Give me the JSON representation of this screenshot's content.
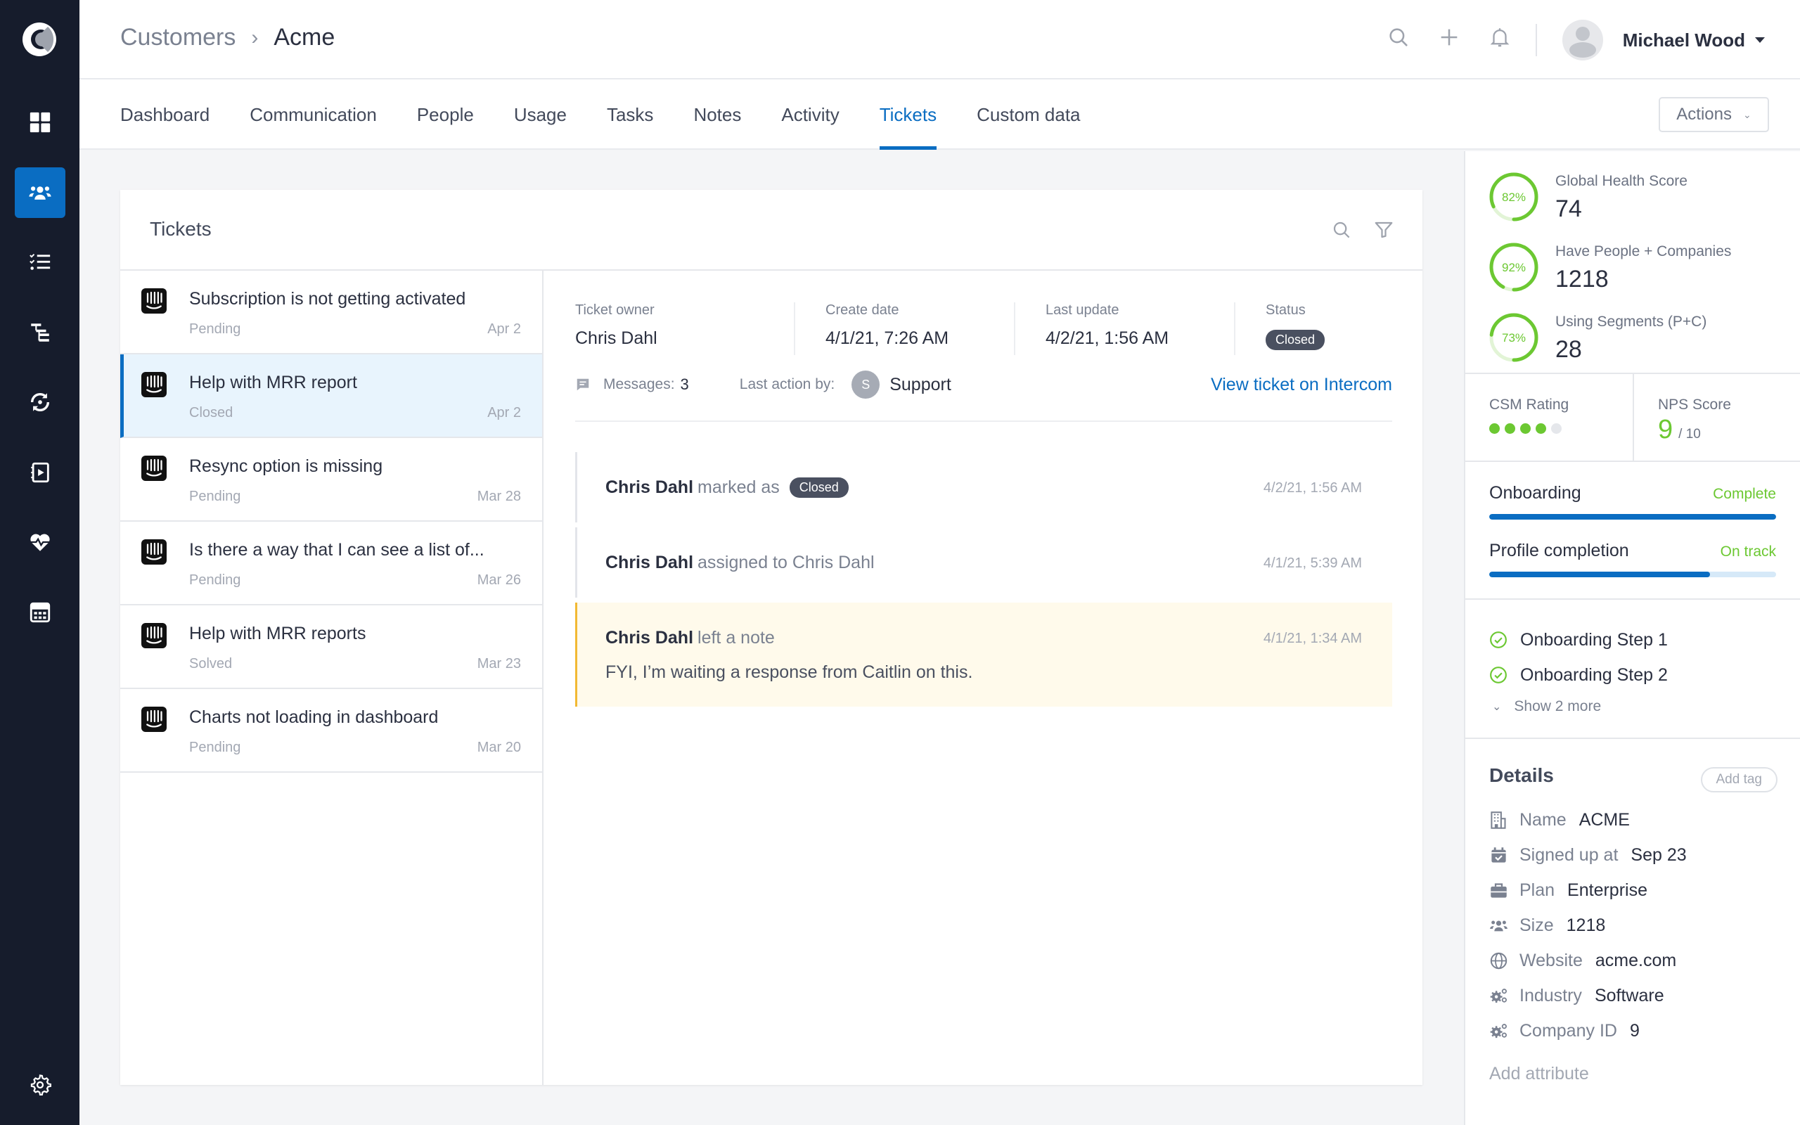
{
  "sidebar": {
    "items": [
      {
        "name": "dashboard",
        "icon": "grid-icon"
      },
      {
        "name": "customers",
        "icon": "users-icon",
        "active": true
      },
      {
        "name": "tasks",
        "icon": "checklist-icon"
      },
      {
        "name": "segments",
        "icon": "hierarchy-icon"
      },
      {
        "name": "sync",
        "icon": "sync-icon"
      },
      {
        "name": "playbooks",
        "icon": "play-notebook-icon"
      },
      {
        "name": "health",
        "icon": "heartbeat-icon"
      },
      {
        "name": "calculator",
        "icon": "calculator-icon"
      }
    ],
    "settings_icon": "gear-icon"
  },
  "header": {
    "breadcrumb_root": "Customers",
    "breadcrumb_sep": "›",
    "breadcrumb_current": "Acme",
    "user_name": "Michael Wood"
  },
  "tabs": [
    {
      "label": "Dashboard"
    },
    {
      "label": "Communication"
    },
    {
      "label": "People"
    },
    {
      "label": "Usage"
    },
    {
      "label": "Tasks"
    },
    {
      "label": "Notes"
    },
    {
      "label": "Activity"
    },
    {
      "label": "Tickets",
      "active": true
    },
    {
      "label": "Custom data"
    }
  ],
  "actions_label": "Actions",
  "tickets": {
    "title": "Tickets",
    "list": [
      {
        "title": "Subscription is not getting activated",
        "status": "Pending",
        "date": "Apr 2"
      },
      {
        "title": "Help with MRR report",
        "status": "Closed",
        "date": "Apr 2",
        "selected": true
      },
      {
        "title": "Resync option is missing",
        "status": "Pending",
        "date": "Mar 28"
      },
      {
        "title": "Is there a way that I can see a list of...",
        "status": "Pending",
        "date": "Mar 26"
      },
      {
        "title": "Help with MRR reports",
        "status": "Solved",
        "date": "Mar 23"
      },
      {
        "title": "Charts not loading in dashboard",
        "status": "Pending",
        "date": "Mar 20"
      }
    ],
    "detail": {
      "owner_label": "Ticket owner",
      "owner": "Chris Dahl",
      "create_label": "Create date",
      "create_date": "4/1/21, 7:26 AM",
      "update_label": "Last update",
      "update_date": "4/2/21, 1:56 AM",
      "status_label": "Status",
      "status": "Closed",
      "messages_label": "Messages:",
      "messages_count": "3",
      "last_action_label": "Last action by:",
      "last_action_initial": "S",
      "last_action_by": "Support",
      "view_link": "View ticket on Intercom",
      "activity": [
        {
          "actor": "Chris Dahl",
          "action": "marked as",
          "badge": "Closed",
          "time": "4/2/21, 1:56 AM"
        },
        {
          "actor": "Chris Dahl",
          "action": "assigned to Chris Dahl",
          "time": "4/1/21, 5:39 AM"
        },
        {
          "actor": "Chris Dahl",
          "action": "left a note",
          "time": "4/1/21, 1:34 AM",
          "note": "FYI, I’m waiting a response from  Caitlin on this."
        }
      ]
    }
  },
  "right_panel": {
    "scores": [
      {
        "percent": 82,
        "percent_label": "82%",
        "label": "Global Health Score",
        "value": "74"
      },
      {
        "percent": 92,
        "percent_label": "92%",
        "label": "Have People + Companies",
        "value": "1218"
      },
      {
        "percent": 73,
        "percent_label": "73%",
        "label": "Using Segments (P+C)",
        "value": "28"
      }
    ],
    "csm_label": "CSM Rating",
    "csm_rating": 4,
    "csm_max": 5,
    "nps_label": "NPS Score",
    "nps_value": "9",
    "nps_max": "/ 10",
    "progress": [
      {
        "label": "Onboarding",
        "status": "Complete",
        "fraction": 1.0
      },
      {
        "label": "Profile completion",
        "status": "On track",
        "fraction": 0.77
      }
    ],
    "steps": [
      {
        "label": "Onboarding Step 1",
        "done": true
      },
      {
        "label": "Onboarding Step 2",
        "done": true
      }
    ],
    "show_more": "Show 2 more",
    "details_title": "Details",
    "add_tag": "Add tag",
    "attributes": [
      {
        "icon": "building-icon",
        "label": "Name",
        "value": "ACME"
      },
      {
        "icon": "calendar-check-icon",
        "label": "Signed up at",
        "value": "Sep 23"
      },
      {
        "icon": "briefcase-icon",
        "label": "Plan",
        "value": "Enterprise"
      },
      {
        "icon": "users-icon",
        "label": "Size",
        "value": "1218"
      },
      {
        "icon": "globe-icon",
        "label": "Website",
        "value": "acme.com"
      },
      {
        "icon": "gears-icon",
        "label": "Industry",
        "value": "Software"
      },
      {
        "icon": "gears-icon",
        "label": "Company ID",
        "value": "9"
      }
    ],
    "add_attribute": "Add attribute"
  },
  "colors": {
    "sidebar_bg": "#161c2c",
    "accent": "#0a6dc2",
    "green": "#6cc832",
    "note_bg": "#fffaeb",
    "note_border": "#f2b933"
  }
}
